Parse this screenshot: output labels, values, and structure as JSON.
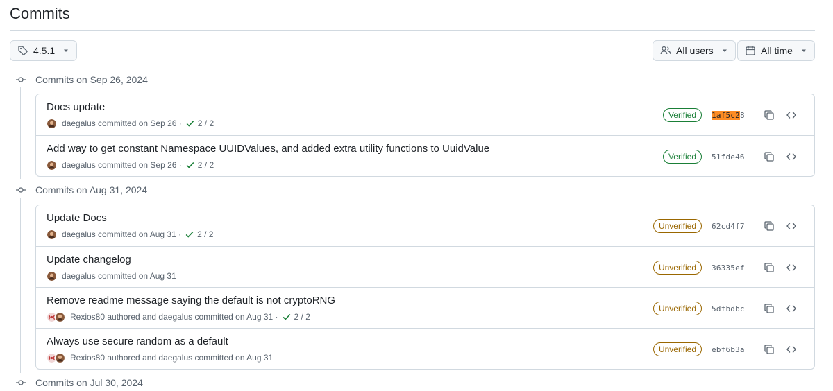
{
  "page": {
    "title": "Commits"
  },
  "filters": {
    "branch_tag": "4.5.1",
    "users": "All users",
    "time": "All time"
  },
  "colors": {
    "verified": "#1a7f37",
    "unverified": "#9a6700",
    "sha_highlight": "#fd8c24",
    "border": "#d1d9e0",
    "muted": "#59636e"
  },
  "groups": [
    {
      "heading": "Commits on Sep 26, 2024",
      "commits": [
        {
          "title": "Docs update",
          "avatars": [
            "daegalus-avatar"
          ],
          "meta": "daegalus committed on Sep 26 ·",
          "checks": "2 / 2",
          "badge": "Verified",
          "badge_type": "verified",
          "sha_highlight": "1af5c2",
          "sha_rest": "8"
        },
        {
          "title": "Add way to get constant Namespace UUIDValues, and added extra utility functions to UuidValue",
          "avatars": [
            "daegalus-avatar"
          ],
          "meta": "daegalus committed on Sep 26 ·",
          "checks": "2 / 2",
          "badge": "Verified",
          "badge_type": "verified",
          "sha_highlight": "",
          "sha_rest": "51fde46"
        }
      ]
    },
    {
      "heading": "Commits on Aug 31, 2024",
      "commits": [
        {
          "title": "Update Docs",
          "avatars": [
            "daegalus-avatar"
          ],
          "meta": "daegalus committed on Aug 31 ·",
          "checks": "2 / 2",
          "badge": "Unverified",
          "badge_type": "unverified",
          "sha_highlight": "",
          "sha_rest": "62cd4f7"
        },
        {
          "title": "Update changelog",
          "avatars": [
            "daegalus-avatar"
          ],
          "meta": "daegalus committed on Aug 31",
          "checks": "",
          "badge": "Unverified",
          "badge_type": "unverified",
          "sha_highlight": "",
          "sha_rest": "36335ef"
        },
        {
          "title": "Remove readme message saying the default is not cryptoRNG",
          "avatars": [
            "rexios80-avatar",
            "daegalus-avatar"
          ],
          "meta": "Rexios80 authored and daegalus committed on Aug 31 ·",
          "checks": "2 / 2",
          "badge": "Unverified",
          "badge_type": "unverified",
          "sha_highlight": "",
          "sha_rest": "5dfbdbc"
        },
        {
          "title": "Always use secure random as a default",
          "avatars": [
            "rexios80-avatar",
            "daegalus-avatar"
          ],
          "meta": "Rexios80 authored and daegalus committed on Aug 31",
          "checks": "",
          "badge": "Unverified",
          "badge_type": "unverified",
          "sha_highlight": "",
          "sha_rest": "ebf6b3a"
        }
      ]
    },
    {
      "heading": "Commits on Jul 30, 2024",
      "commits": []
    }
  ]
}
